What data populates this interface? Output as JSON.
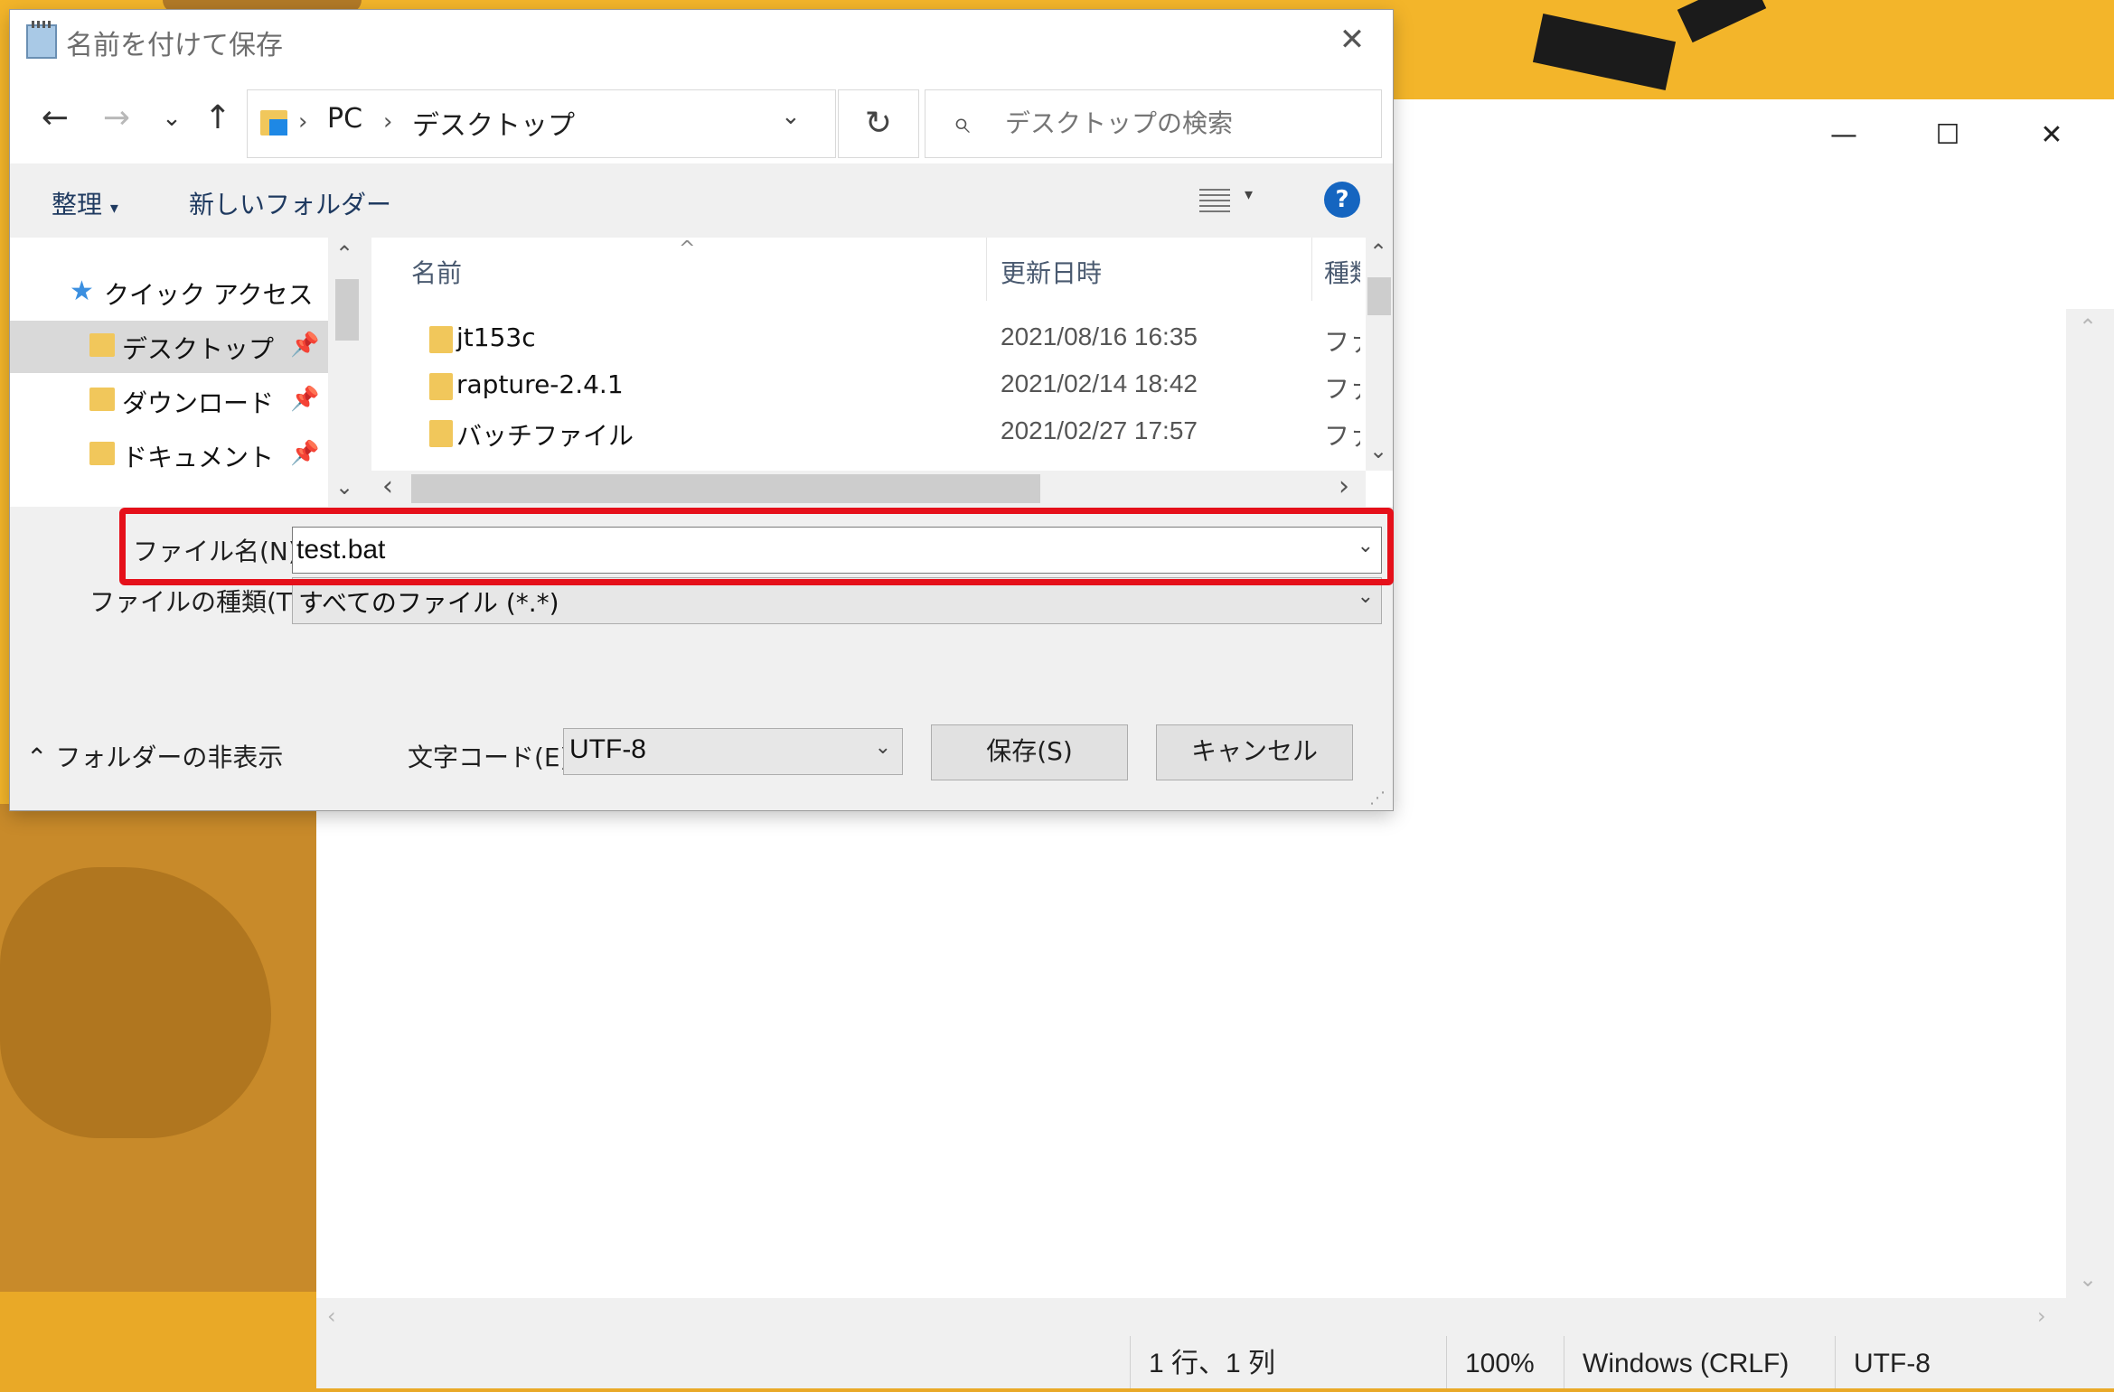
{
  "notepad": {
    "window_controls": {
      "minimize": "—",
      "maximize": "☐",
      "close": "✕"
    },
    "status": {
      "position": "1 行、1 列",
      "zoom": "100%",
      "line_ending": "Windows (CRLF)",
      "encoding": "UTF-8"
    }
  },
  "dialog": {
    "title": "名前を付けて保存",
    "close": "✕",
    "nav": {
      "back": "←",
      "forward": "→",
      "recent": "⌄",
      "up": "↑",
      "refresh": "↻"
    },
    "breadcrumb": [
      "PC",
      "デスクトップ"
    ],
    "breadcrumb_sep": "›",
    "search_placeholder": "デスクトップの検索",
    "toolbar": {
      "organize": "整理",
      "organize_arrow": "▾",
      "new_folder": "新しいフォルダー",
      "help": "?"
    },
    "nav_pane": {
      "quick_access": "クイック アクセス",
      "items": [
        {
          "label": "デスクトップ",
          "selected": true
        },
        {
          "label": "ダウンロード",
          "selected": false
        },
        {
          "label": "ドキュメント",
          "selected": false
        }
      ]
    },
    "columns": {
      "name": "名前",
      "modified": "更新日時",
      "type": "種類"
    },
    "files": [
      {
        "name": "jt153c",
        "modified": "2021/08/16 16:35",
        "type": "ファイル フォルダー"
      },
      {
        "name": "rapture-2.4.1",
        "modified": "2021/02/14 18:42",
        "type": "ファイル フォルダー"
      },
      {
        "name": "バッチファイル",
        "modified": "2021/02/27 17:57",
        "type": "ファイル フォルダー"
      }
    ],
    "filename_label": "ファイル名(N):",
    "filename_value": "test.bat",
    "filetype_label": "ファイルの種類(T):",
    "filetype_value": "すべてのファイル  (*.*)",
    "hide_folders": "フォルダーの非表示",
    "encoding_label": "文字コード(E):",
    "encoding_value": "UTF-8",
    "save_button": "保存(S)",
    "cancel_button": "キャンセル",
    "highlight_color": "#e5101a"
  }
}
